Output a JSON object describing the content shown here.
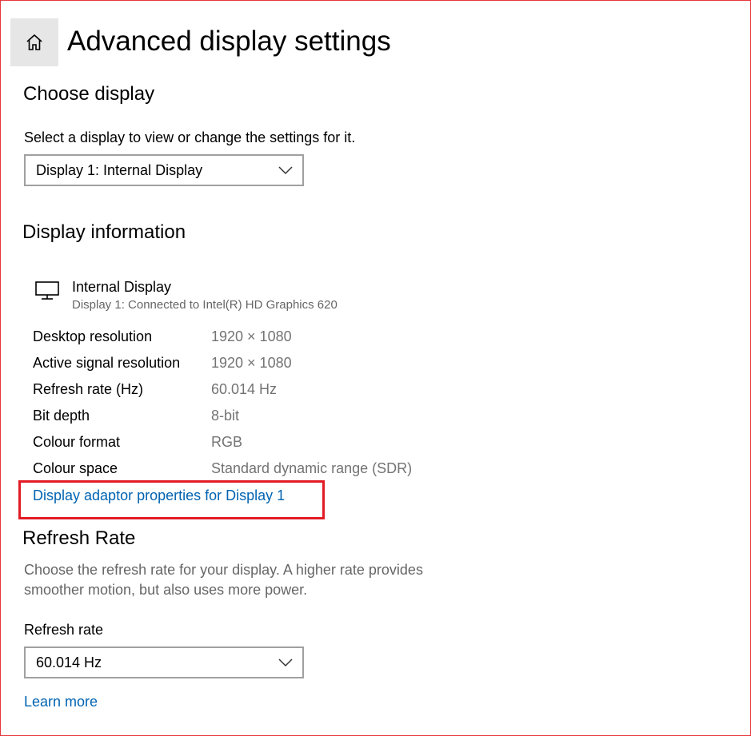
{
  "page": {
    "title": "Advanced display settings"
  },
  "choose_display": {
    "heading": "Choose display",
    "instruction": "Select a display to view or change the settings for it.",
    "selected_display": "Display 1: Internal Display"
  },
  "display_info": {
    "heading": "Display information",
    "device_name": "Internal Display",
    "device_subtitle": "Display 1: Connected to Intel(R) HD Graphics 620",
    "rows": [
      {
        "label": "Desktop resolution",
        "value": "1920 × 1080"
      },
      {
        "label": "Active signal resolution",
        "value": "1920 × 1080"
      },
      {
        "label": "Refresh rate (Hz)",
        "value": "60.014 Hz"
      },
      {
        "label": "Bit depth",
        "value": "8-bit"
      },
      {
        "label": "Colour format",
        "value": "RGB"
      },
      {
        "label": "Colour space",
        "value": "Standard dynamic range (SDR)"
      }
    ],
    "adaptor_link": "Display adaptor properties for Display 1"
  },
  "refresh_rate": {
    "heading": "Refresh Rate",
    "description": "Choose the refresh rate for your display. A higher rate provides smoother motion, but also uses more power.",
    "field_label": "Refresh rate",
    "selected_rate": "60.014 Hz",
    "learn_more": "Learn more"
  },
  "icons": {
    "home": "home-icon",
    "monitor": "monitor-icon",
    "dropdown": "chevron-down-icon"
  },
  "colors": {
    "link": "#0063b1",
    "highlight": "#e21b24",
    "frame": "#e8363b",
    "secondary_text": "#737373"
  }
}
